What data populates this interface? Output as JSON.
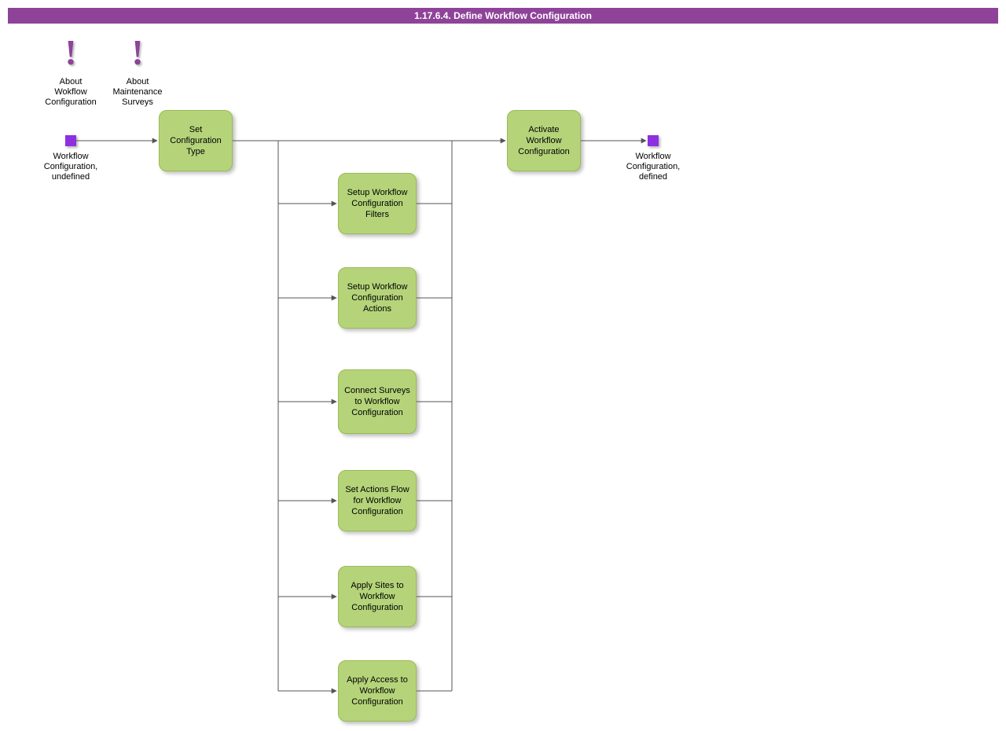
{
  "title": "1.17.6.4. Define Workflow Configuration",
  "notes": {
    "n1": {
      "symbol": "!",
      "line1": "About",
      "line2": "Wokflow",
      "line3": "Configuration"
    },
    "n2": {
      "symbol": "!",
      "line1": "About",
      "line2": "Maintenance",
      "line3": "Surveys"
    }
  },
  "terminals": {
    "start": {
      "line1": "Workflow",
      "line2": "Configuration,",
      "line3": "undefined"
    },
    "end": {
      "line1": "Workflow",
      "line2": "Configuration,",
      "line3": "defined"
    }
  },
  "boxes": {
    "b1": "Set Configuration Type",
    "b2": "Setup Workflow Configuration Filters",
    "b3": "Setup Workflow Configuration Actions",
    "b4": "Connect Surveys to Workflow Configuration",
    "b5": "Set Actions Flow for Workflow Configuration",
    "b6": "Apply Sites to Workflow Configuration",
    "b7": "Apply Access to Workflow Configuration",
    "b8": "Activate Workflow Configuration"
  },
  "colors": {
    "header": "#8e4399",
    "box_fill": "#b5d47a",
    "terminal": "#8e30e0"
  }
}
